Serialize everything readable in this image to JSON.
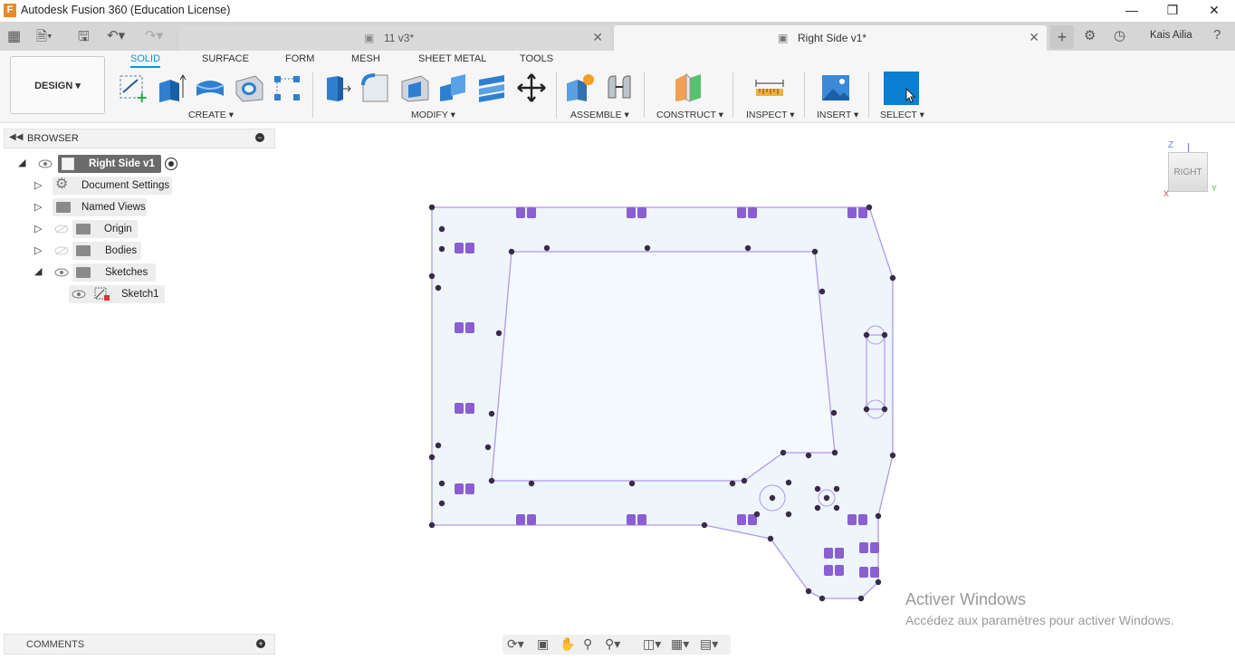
{
  "window": {
    "title": "Autodesk Fusion 360 (Education License)",
    "logo_letter": "F"
  },
  "tabs": [
    {
      "label": "11 v3*"
    },
    {
      "label": "Right Side v1*"
    }
  ],
  "user": {
    "name": "Kais Ailia"
  },
  "ribbon": {
    "workspace": "DESIGN",
    "tabs": [
      "SOLID",
      "SURFACE",
      "FORM",
      "MESH",
      "SHEET METAL",
      "TOOLS"
    ],
    "groups": [
      "CREATE",
      "MODIFY",
      "ASSEMBLE",
      "CONSTRUCT",
      "INSPECT",
      "INSERT",
      "SELECT"
    ]
  },
  "browser": {
    "title": "BROWSER",
    "root": "Right Side v1",
    "items": [
      {
        "label": "Document Settings",
        "icon": "gear-icon"
      },
      {
        "label": "Named Views",
        "icon": "folder-icon"
      },
      {
        "label": "Origin",
        "icon": "folder-icon"
      },
      {
        "label": "Bodies",
        "icon": "folder-icon"
      },
      {
        "label": "Sketches",
        "icon": "folder-icon"
      },
      {
        "label": "Sketch1",
        "icon": "sketch-icon"
      }
    ]
  },
  "comments": {
    "title": "COMMENTS"
  },
  "viewcube": {
    "face": "RIGHT",
    "axis_z": "Z",
    "axis_y": "Y",
    "axis_x": "X"
  },
  "watermark": {
    "line1": "Activer Windows",
    "line2": "Accédez aux paramètres pour activer Windows."
  },
  "colors": {
    "accent": "#0696d7",
    "sketch_line": "#a98be0",
    "sketch_fill": "#f0f6fc",
    "constraint": "#8a5fd1",
    "point": "#3a2a4a"
  }
}
